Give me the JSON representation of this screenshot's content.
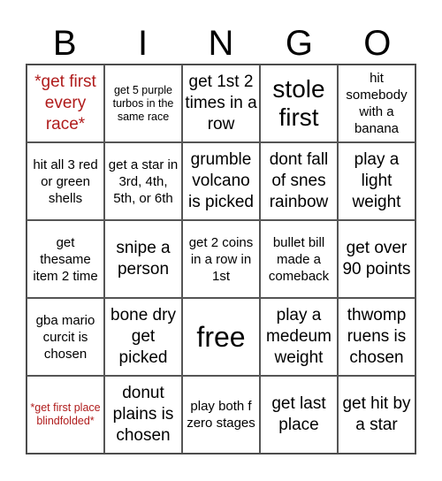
{
  "header": [
    "B",
    "I",
    "N",
    "G",
    "O"
  ],
  "colors": {
    "special_text": "#b01c1c"
  },
  "cells": [
    {
      "text": "*get first every race*",
      "size": "md",
      "red": true
    },
    {
      "text": "get 5 purple turbos in the same race",
      "size": "xs",
      "red": false
    },
    {
      "text": "get 1st 2 times in a row",
      "size": "md",
      "red": false
    },
    {
      "text": "stole first",
      "size": "lg",
      "red": false
    },
    {
      "text": "hit somebody with a banana",
      "size": "sm",
      "red": false
    },
    {
      "text": "hit all 3 red or green shells",
      "size": "sm",
      "red": false
    },
    {
      "text": "get a star in 3rd, 4th, 5th, or 6th",
      "size": "sm",
      "red": false
    },
    {
      "text": "grumble volcano is picked",
      "size": "md",
      "red": false
    },
    {
      "text": "dont fall of snes rainbow",
      "size": "md",
      "red": false
    },
    {
      "text": "play a light weight",
      "size": "md",
      "red": false
    },
    {
      "text": "get thesame item 2 time",
      "size": "sm",
      "red": false
    },
    {
      "text": "snipe a person",
      "size": "md",
      "red": false
    },
    {
      "text": "get 2 coins in a row in 1st",
      "size": "sm",
      "red": false
    },
    {
      "text": "bullet bill made a comeback",
      "size": "sm",
      "red": false
    },
    {
      "text": "get over 90 points",
      "size": "md",
      "red": false
    },
    {
      "text": "gba mario curcit is chosen",
      "size": "sm",
      "red": false
    },
    {
      "text": "bone dry get picked",
      "size": "md",
      "red": false
    },
    {
      "text": "free",
      "size": "xl",
      "red": false
    },
    {
      "text": "play a medeum weight",
      "size": "md",
      "red": false
    },
    {
      "text": "thwomp ruens is chosen",
      "size": "md",
      "red": false
    },
    {
      "text": "*get first place blindfolded*",
      "size": "xs",
      "red": true
    },
    {
      "text": "donut plains is chosen",
      "size": "md",
      "red": false
    },
    {
      "text": "play both f zero stages",
      "size": "sm",
      "red": false
    },
    {
      "text": "get last place",
      "size": "md",
      "red": false
    },
    {
      "text": "get hit by a star",
      "size": "md",
      "red": false
    }
  ]
}
